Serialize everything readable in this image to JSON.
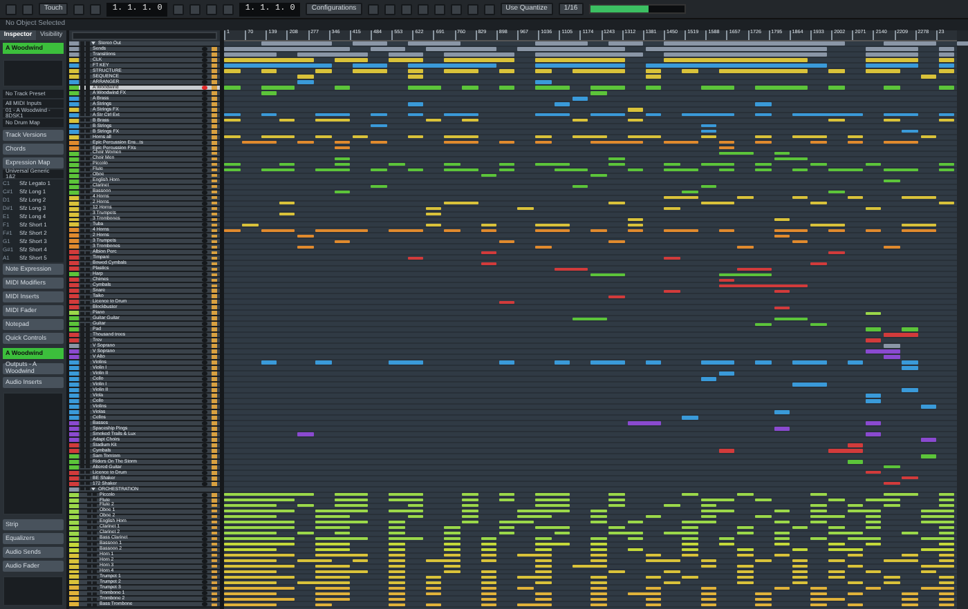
{
  "toolbar": {
    "automation_mode": "Touch",
    "position": "1. 1. 1. 0",
    "end_position": "1. 1. 1. 0",
    "configurations": "Configurations",
    "quantize_mode": "Use Quantize",
    "quantize": "1/16",
    "meter": {
      "level": 0.62
    }
  },
  "status": "No Object Selected",
  "inspector": {
    "tabs": [
      {
        "label": "Inspector",
        "selected": true
      },
      {
        "label": "Visibility",
        "selected": false
      }
    ],
    "track_name": "A Woodwind",
    "routing": [
      "No Track Preset",
      "All MIDI Inputs",
      "01 - A Woodwind - 8DSK1"
    ],
    "drum_map": "No Drum Map",
    "sections_top": [
      "Track Versions",
      "Chords",
      "Expression Map"
    ],
    "expression_map": "Universal Generic 1&2",
    "articulations": [
      {
        "key": "C1",
        "name": "Sfz Legato 1"
      },
      {
        "key": "C#1",
        "name": "Sfz Long 1"
      },
      {
        "key": "D1",
        "name": "Sfz Long 2"
      },
      {
        "key": "D#1",
        "name": "Sfz Long 3"
      },
      {
        "key": "E1",
        "name": "Sfz Long 4"
      },
      {
        "key": "F1",
        "name": "Sfz Short 1"
      },
      {
        "key": "F#1",
        "name": "Sfz Short 2"
      },
      {
        "key": "G1",
        "name": "Sfz Short 3"
      },
      {
        "key": "G#1",
        "name": "Sfz Short 4"
      },
      {
        "key": "A1",
        "name": "Sfz Short 5"
      }
    ],
    "sections_mid": [
      "Note Expression",
      "MIDI Modifiers",
      "MIDI Inserts",
      "MIDI Fader",
      "Notepad",
      "Quick Controls"
    ],
    "channel": "A Woodwind",
    "sections_channel": [
      "Outputs - A Woodwind",
      "Audio Inserts"
    ],
    "sections_bottom": [
      "Strip",
      "Equalizers",
      "Audio Sends",
      "Audio Fader"
    ]
  },
  "ruler": [
    "1",
    "70",
    "139",
    "208",
    "277",
    "346",
    "415",
    "484",
    "553",
    "622",
    "691",
    "760",
    "829",
    "898",
    "967",
    "1036",
    "1105",
    "1174",
    "1243",
    "1312",
    "1381",
    "1450",
    "1519",
    "1588",
    "1657",
    "1726",
    "1795",
    "1864",
    "1933",
    "2002",
    "2071",
    "2140",
    "2209",
    "2278",
    "23"
  ],
  "tracks": [
    {
      "name": "Stereo Out",
      "color": "#8a96a6",
      "kind": "folder",
      "selected": false
    },
    {
      "name": "Sends",
      "color": "#8a96a6",
      "kind": "midi",
      "selected": false,
      "armed": false
    },
    {
      "name": "Transitions",
      "color": "#8a96a6",
      "kind": "midi",
      "selected": false,
      "armed": false
    },
    {
      "name": "CLK",
      "color": "#d9c23a",
      "kind": "midi",
      "selected": false,
      "armed": false
    },
    {
      "name": "FT KEY",
      "color": "#3a9ad9",
      "kind": "midi",
      "selected": false,
      "armed": false
    },
    {
      "name": "STRUCTURE",
      "color": "#d9c23a",
      "kind": "midi",
      "selected": false,
      "armed": false
    },
    {
      "name": "SEQUENCE",
      "color": "#d9c23a",
      "kind": "midi",
      "selected": false,
      "armed": false
    },
    {
      "name": "ARRANGER",
      "color": "#3a9ad9",
      "kind": "midi",
      "selected": false,
      "armed": false
    },
    {
      "name": "A Woodwind",
      "color": "#5cc43a",
      "kind": "midi",
      "selected": true,
      "armed": true
    },
    {
      "name": "A Woodwind FX",
      "color": "#5cc43a",
      "kind": "midi",
      "selected": false,
      "armed": false
    },
    {
      "name": "A Brass",
      "color": "#3a9ad9",
      "kind": "midi",
      "selected": false,
      "armed": false
    },
    {
      "name": "A Strings",
      "color": "#3a9ad9",
      "kind": "midi",
      "selected": false,
      "armed": false
    },
    {
      "name": "A Strings FX",
      "color": "#d9c23a",
      "kind": "midi",
      "selected": false,
      "armed": false
    },
    {
      "name": "A Str Ctrl Ext",
      "color": "#3a9ad9",
      "kind": "midi",
      "selected": false,
      "armed": false
    },
    {
      "name": "B Brass",
      "color": "#d9c23a",
      "kind": "midi",
      "selected": false,
      "armed": false
    },
    {
      "name": "B Strings",
      "color": "#3a9ad9",
      "kind": "midi",
      "selected": false,
      "armed": false
    },
    {
      "name": "B Strings FX",
      "color": "#3a9ad9",
      "kind": "midi",
      "selected": false,
      "armed": false
    },
    {
      "name": "Horns all",
      "color": "#d9c23a",
      "kind": "midi",
      "selected": false,
      "armed": false
    },
    {
      "name": "Epic Percussion Ens...ts",
      "color": "#e08a2e",
      "kind": "midi",
      "selected": false,
      "armed": false
    },
    {
      "name": "Epic Percussion FXs",
      "color": "#e08a2e",
      "kind": "midi",
      "selected": false,
      "armed": false
    },
    {
      "name": "Choir Women",
      "color": "#5cc43a",
      "kind": "midi",
      "selected": false,
      "armed": false
    },
    {
      "name": "Choir Men",
      "color": "#5cc43a",
      "kind": "midi",
      "selected": false,
      "armed": false
    },
    {
      "name": "Piccolo",
      "color": "#5cc43a",
      "kind": "midi",
      "selected": false,
      "armed": false
    },
    {
      "name": "Flute",
      "color": "#5cc43a",
      "kind": "midi",
      "selected": false,
      "armed": false
    },
    {
      "name": "Oboe",
      "color": "#5cc43a",
      "kind": "midi",
      "selected": false,
      "armed": false
    },
    {
      "name": "English Horn",
      "color": "#5cc43a",
      "kind": "midi",
      "selected": false,
      "armed": false
    },
    {
      "name": "Clarinet",
      "color": "#5cc43a",
      "kind": "midi",
      "selected": false,
      "armed": false
    },
    {
      "name": "Bassoon",
      "color": "#5cc43a",
      "kind": "midi",
      "selected": false,
      "armed": false
    },
    {
      "name": "4 Horns",
      "color": "#d9c23a",
      "kind": "midi",
      "selected": false,
      "armed": false
    },
    {
      "name": "2 Horns",
      "color": "#d9c23a",
      "kind": "midi",
      "selected": false,
      "armed": false
    },
    {
      "name": "12 Horns",
      "color": "#d9c23a",
      "kind": "midi",
      "selected": false,
      "armed": false
    },
    {
      "name": "3 Trumpets",
      "color": "#d9c23a",
      "kind": "midi",
      "selected": false,
      "armed": false
    },
    {
      "name": "3 Trombones",
      "color": "#d9c23a",
      "kind": "midi",
      "selected": false,
      "armed": false
    },
    {
      "name": "Tuba",
      "color": "#d9c23a",
      "kind": "midi",
      "selected": false,
      "armed": false
    },
    {
      "name": "4 Horns",
      "color": "#e08a2e",
      "kind": "midi",
      "selected": false,
      "armed": false
    },
    {
      "name": "2 Horns",
      "color": "#e08a2e",
      "kind": "midi",
      "selected": false,
      "armed": false
    },
    {
      "name": "3 Trumpets",
      "color": "#e08a2e",
      "kind": "midi",
      "selected": false,
      "armed": false
    },
    {
      "name": "3 Trombones",
      "color": "#e08a2e",
      "kind": "midi",
      "selected": false,
      "armed": false
    },
    {
      "name": "Albion Perc",
      "color": "#d23b3b",
      "kind": "midi",
      "selected": false,
      "armed": false
    },
    {
      "name": "Timpani",
      "color": "#d23b3b",
      "kind": "midi",
      "selected": false,
      "armed": false
    },
    {
      "name": "Bowed Cymbals",
      "color": "#d23b3b",
      "kind": "midi",
      "selected": false,
      "armed": false
    },
    {
      "name": "Plastics",
      "color": "#d23b3b",
      "kind": "midi",
      "selected": false,
      "armed": false
    },
    {
      "name": "Harp",
      "color": "#5cc43a",
      "kind": "midi",
      "selected": false,
      "armed": false
    },
    {
      "name": "Chimes",
      "color": "#d23b3b",
      "kind": "midi",
      "selected": false,
      "armed": false
    },
    {
      "name": "Cymbals",
      "color": "#d23b3b",
      "kind": "midi",
      "selected": false,
      "armed": false
    },
    {
      "name": "Snare",
      "color": "#d23b3b",
      "kind": "midi",
      "selected": false,
      "armed": false
    },
    {
      "name": "Taiko",
      "color": "#d23b3b",
      "kind": "midi",
      "selected": false,
      "armed": false
    },
    {
      "name": "Licence to Drum",
      "color": "#d23b3b",
      "kind": "midi",
      "selected": false,
      "armed": false
    },
    {
      "name": "Blockbuster",
      "color": "#d23b3b",
      "kind": "midi",
      "selected": false,
      "armed": false
    },
    {
      "name": "Piano",
      "color": "#9bd84a",
      "kind": "midi",
      "selected": false,
      "armed": false
    },
    {
      "name": "Guitar Guitar",
      "color": "#5cc43a",
      "kind": "midi",
      "selected": false,
      "armed": false
    },
    {
      "name": "Guitar",
      "color": "#5cc43a",
      "kind": "midi",
      "selected": false,
      "armed": false
    },
    {
      "name": "Pad",
      "color": "#5cc43a",
      "kind": "midi",
      "selected": false,
      "armed": false
    },
    {
      "name": "Thousand trees",
      "color": "#d23b3b",
      "kind": "midi",
      "selected": false,
      "armed": false
    },
    {
      "name": "Trev",
      "color": "#d23b3b",
      "kind": "midi",
      "selected": false,
      "armed": false
    },
    {
      "name": "V Soprano",
      "color": "#8a96a6",
      "kind": "midi",
      "selected": false,
      "armed": false
    },
    {
      "name": "V Soprano",
      "color": "#8a4ad0",
      "kind": "midi",
      "selected": false,
      "armed": false
    },
    {
      "name": "V Alto",
      "color": "#8a4ad0",
      "kind": "midi",
      "selected": false,
      "armed": false
    },
    {
      "name": "Violins",
      "color": "#3a9ad9",
      "kind": "midi",
      "selected": false,
      "armed": false
    },
    {
      "name": "Violin I",
      "color": "#3a9ad9",
      "kind": "midi",
      "selected": false,
      "armed": false
    },
    {
      "name": "Violin II",
      "color": "#3a9ad9",
      "kind": "midi",
      "selected": false,
      "armed": false
    },
    {
      "name": "Cello",
      "color": "#3a9ad9",
      "kind": "midi",
      "selected": false,
      "armed": false
    },
    {
      "name": "Violin I",
      "color": "#3a9ad9",
      "kind": "midi",
      "selected": false,
      "armed": false
    },
    {
      "name": "Violin II",
      "color": "#3a9ad9",
      "kind": "midi",
      "selected": false,
      "armed": false
    },
    {
      "name": "Viola",
      "color": "#3a9ad9",
      "kind": "midi",
      "selected": false,
      "armed": false
    },
    {
      "name": "Cello",
      "color": "#3a9ad9",
      "kind": "midi",
      "selected": false,
      "armed": false
    },
    {
      "name": "Violins",
      "color": "#3a9ad9",
      "kind": "midi",
      "selected": false,
      "armed": false
    },
    {
      "name": "Violas",
      "color": "#3a9ad9",
      "kind": "midi",
      "selected": false,
      "armed": false
    },
    {
      "name": "Cellos",
      "color": "#3a9ad9",
      "kind": "midi",
      "selected": false,
      "armed": false
    },
    {
      "name": "Basses",
      "color": "#8a4ad0",
      "kind": "midi",
      "selected": false,
      "armed": false
    },
    {
      "name": "Spaceship Pings",
      "color": "#8a4ad0",
      "kind": "midi",
      "selected": false,
      "armed": false
    },
    {
      "name": "Smoked Trails & Lux",
      "color": "#8a4ad0",
      "kind": "midi",
      "selected": false,
      "armed": false
    },
    {
      "name": "Adapt Choirs",
      "color": "#8a4ad0",
      "kind": "midi",
      "selected": false,
      "armed": false
    },
    {
      "name": "Stadium Kit",
      "color": "#d23b3b",
      "kind": "midi",
      "selected": false,
      "armed": false
    },
    {
      "name": "Cymbals",
      "color": "#d23b3b",
      "kind": "midi",
      "selected": false,
      "armed": false
    },
    {
      "name": "Sam Tomtom",
      "color": "#5cc43a",
      "kind": "midi",
      "selected": false,
      "armed": false
    },
    {
      "name": "Riders On The Storm",
      "color": "#5cc43a",
      "kind": "midi",
      "selected": false,
      "armed": false
    },
    {
      "name": "Altered Guitar",
      "color": "#5cc43a",
      "kind": "midi",
      "selected": false,
      "armed": false
    },
    {
      "name": "Licence to Drum",
      "color": "#d23b3b",
      "kind": "midi",
      "selected": false,
      "armed": false
    },
    {
      "name": "BE Shaker",
      "color": "#d23b3b",
      "kind": "midi",
      "selected": false,
      "armed": false
    },
    {
      "name": "172 Shaker",
      "color": "#d23b3b",
      "kind": "midi",
      "selected": false,
      "armed": false
    },
    {
      "name": "ORCHESTRATION",
      "color": "#8a96a6",
      "kind": "folder",
      "selected": false,
      "children": [
        {
          "name": "Piccolo",
          "color": "#9bd84a",
          "kind": "midi",
          "selected": false,
          "armed": false
        },
        {
          "name": "Flute",
          "color": "#9bd84a",
          "kind": "midi",
          "selected": false,
          "armed": false
        },
        {
          "name": "Flute 2",
          "color": "#9bd84a",
          "kind": "midi",
          "selected": false,
          "armed": false
        },
        {
          "name": "Oboe 1",
          "color": "#9bd84a",
          "kind": "midi",
          "selected": false,
          "armed": false
        },
        {
          "name": "Oboe 2",
          "color": "#9bd84a",
          "kind": "midi",
          "selected": false,
          "armed": false
        },
        {
          "name": "English Horn",
          "color": "#9bd84a",
          "kind": "midi",
          "selected": false,
          "armed": false
        },
        {
          "name": "Clarinet 1",
          "color": "#9bd84a",
          "kind": "midi",
          "selected": false,
          "armed": false
        },
        {
          "name": "Clarinet 2",
          "color": "#9bd84a",
          "kind": "midi",
          "selected": false,
          "armed": false
        },
        {
          "name": "Bass Clarinet",
          "color": "#9bd84a",
          "kind": "midi",
          "selected": false,
          "armed": false
        },
        {
          "name": "Bassoon 1",
          "color": "#c4d93a",
          "kind": "midi",
          "selected": false,
          "armed": false
        },
        {
          "name": "Bassoon 2",
          "color": "#c4d93a",
          "kind": "midi",
          "selected": false,
          "armed": false
        },
        {
          "name": "Horn 1",
          "color": "#d9c23a",
          "kind": "midi",
          "selected": false,
          "armed": false
        },
        {
          "name": "Horn 2",
          "color": "#d9c23a",
          "kind": "midi",
          "selected": false,
          "armed": false
        },
        {
          "name": "Horn 3",
          "color": "#d9c23a",
          "kind": "midi",
          "selected": false,
          "armed": false
        },
        {
          "name": "Horn 4",
          "color": "#d9c23a",
          "kind": "midi",
          "selected": false,
          "armed": false
        },
        {
          "name": "Trumpet 1",
          "color": "#d9c23a",
          "kind": "midi",
          "selected": false,
          "armed": false
        },
        {
          "name": "Trumpet 2",
          "color": "#d9c23a",
          "kind": "midi",
          "selected": false,
          "armed": false
        },
        {
          "name": "Trumpet 3",
          "color": "#e0b23a",
          "kind": "midi",
          "selected": false,
          "armed": false
        },
        {
          "name": "Trombone 1",
          "color": "#e0b23a",
          "kind": "midi",
          "selected": false,
          "armed": false
        },
        {
          "name": "Trombone 2",
          "color": "#e0b23a",
          "kind": "midi",
          "selected": false,
          "armed": false
        },
        {
          "name": "Bass Trombone",
          "color": "#e0b23a",
          "kind": "midi",
          "selected": false,
          "armed": false
        }
      ]
    }
  ]
}
